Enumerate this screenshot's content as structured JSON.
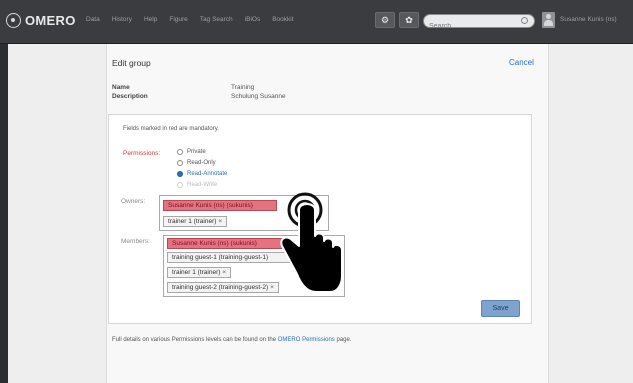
{
  "app": {
    "logo_text": "OMERO"
  },
  "nav": {
    "items": [
      "Data",
      "History",
      "Help",
      "Figure",
      "Tag Search",
      "iBiOs",
      "Bookkit"
    ]
  },
  "toolbar": {
    "tool_icon_1": "tools-icon",
    "tool_icon_2": "scripts-icon"
  },
  "search": {
    "placeholder": "Search"
  },
  "user": {
    "name": "Susanne Kunis (ns)"
  },
  "edit_group": {
    "title": "Edit group",
    "cancel_label": "Cancel",
    "name_label": "Name",
    "name_value": "Training",
    "description_label": "Description",
    "description_value": "Schulung Susanne"
  },
  "form": {
    "mandatory_note": "Fields marked in red are mandatory.",
    "permissions_label": "Permissions:",
    "permissions_options": [
      "Private",
      "Read-Only",
      "Read-Annotate",
      "Read-Write"
    ],
    "permissions_selected": "Read-Annotate",
    "owners_label": "Owners:",
    "owners": [
      "Susanne Kunis (ns) (sukunis)",
      "trainer 1 (trainer)"
    ],
    "members_label": "Members:",
    "members": [
      "Susanne Kunis (ns) (sukunis)",
      "training guest-1 (training-guest-1)",
      "trainer 1 (trainer)",
      "training guest-2 (training-guest-2)"
    ],
    "remove_glyph": "×",
    "save_label": "Save"
  },
  "footer": {
    "note_before": "Full details on various Permissions levels can be found on the",
    "link_text": "OMERO Permissions",
    "note_after": "page."
  },
  "overlay": {
    "icon": "tap-hand-icon"
  }
}
